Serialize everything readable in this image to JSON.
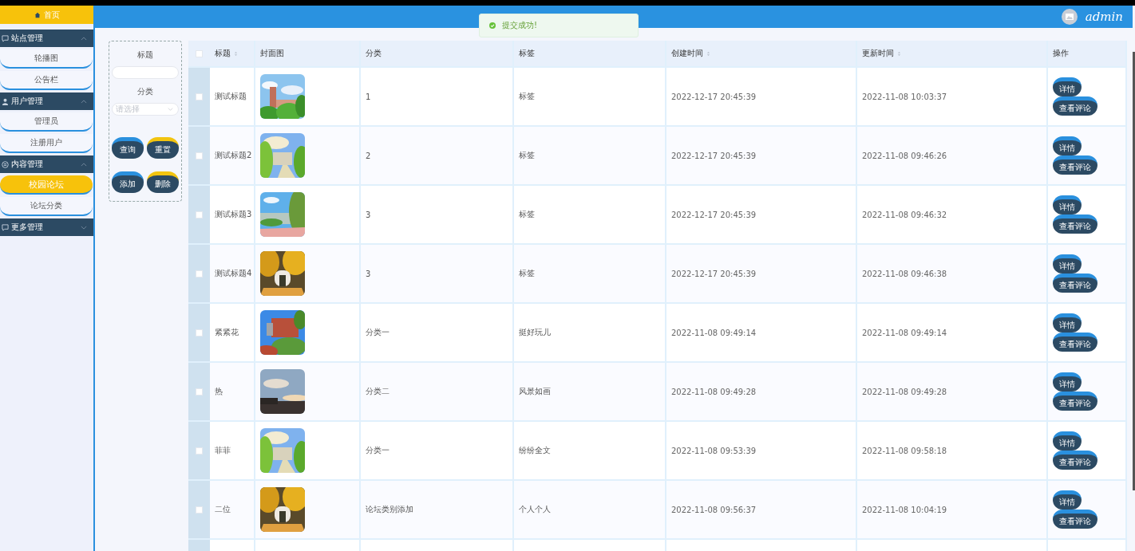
{
  "sidebar": {
    "home": {
      "label": "首页"
    },
    "groups": [
      {
        "label": "站点管理",
        "expanded": true,
        "items": [
          {
            "label": "轮播图",
            "selected": false
          },
          {
            "label": "公告栏",
            "selected": false
          }
        ]
      },
      {
        "label": "用户管理",
        "expanded": true,
        "items": [
          {
            "label": "管理员",
            "selected": false
          },
          {
            "label": "注册用户",
            "selected": false
          }
        ]
      },
      {
        "label": "内容管理",
        "expanded": true,
        "items": [
          {
            "label": "校园论坛",
            "selected": true
          },
          {
            "label": "论坛分类",
            "selected": false
          }
        ]
      },
      {
        "label": "更多管理",
        "expanded": false
      }
    ]
  },
  "header": {
    "user": "admin"
  },
  "toast": {
    "message": "提交成功!"
  },
  "filter": {
    "fields": [
      {
        "label": "标题",
        "kind": "text"
      },
      {
        "label": "分类",
        "kind": "select",
        "placeholder": "请选择"
      }
    ],
    "buttons": [
      {
        "label": "查询",
        "color": "#2a90de"
      },
      {
        "label": "重置",
        "color": "#f2c40f"
      },
      {
        "label": "添加",
        "color": "#2a90de"
      },
      {
        "label": "删除",
        "color": "#f2c40f"
      }
    ]
  },
  "table": {
    "all_checked": false,
    "columns": [
      {
        "label": "标题",
        "sortable": true
      },
      {
        "label": "封面图",
        "sortable": false
      },
      {
        "label": "分类",
        "sortable": false
      },
      {
        "label": "标签",
        "sortable": false
      },
      {
        "label": "创建时间",
        "sortable": true
      },
      {
        "label": "更新时间",
        "sortable": true
      },
      {
        "label": "操作",
        "sortable": false
      }
    ],
    "rows": [
      {
        "checked": false,
        "title": "测试标题",
        "category": "1",
        "tag": "标签",
        "created": "2022-12-17 20:45:39",
        "updated": "2022-11-08 10:03:37",
        "actions": [
          "详情",
          "查看评论"
        ]
      },
      {
        "checked": false,
        "title": "测试标题2",
        "category": "2",
        "tag": "标签",
        "created": "2022-12-17 20:45:39",
        "updated": "2022-11-08 09:46:26",
        "actions": [
          "详情",
          "查看评论"
        ]
      },
      {
        "checked": false,
        "title": "测试标题3",
        "category": "3",
        "tag": "标签",
        "created": "2022-12-17 20:45:39",
        "updated": "2022-11-08 09:46:32",
        "actions": [
          "详情",
          "查看评论"
        ]
      },
      {
        "checked": false,
        "title": "测试标题4",
        "category": "3",
        "tag": "标签",
        "created": "2022-12-17 20:45:39",
        "updated": "2022-11-08 09:46:38",
        "actions": [
          "详情",
          "查看评论"
        ]
      },
      {
        "checked": false,
        "title": "紧紧花",
        "category": "分类一",
        "tag": "挺好玩儿",
        "created": "2022-11-08 09:49:14",
        "updated": "2022-11-08 09:49:14",
        "actions": [
          "详情",
          "查看评论"
        ]
      },
      {
        "checked": false,
        "title": "热",
        "category": "分类二",
        "tag": "风景如画",
        "created": "2022-11-08 09:49:28",
        "updated": "2022-11-08 09:49:28",
        "actions": [
          "详情",
          "查看评论"
        ]
      },
      {
        "checked": false,
        "title": "菲菲",
        "category": "分类一",
        "tag": "纷纷全文",
        "created": "2022-11-08 09:53:39",
        "updated": "2022-11-08 09:58:18",
        "actions": [
          "详情",
          "查看评论"
        ]
      },
      {
        "checked": false,
        "title": "二位",
        "category": "论坛类别添加",
        "tag": "个人个人",
        "created": "2022-11-08 09:56:37",
        "updated": "2022-11-08 10:04:19",
        "actions": [
          "详情",
          "查看评论"
        ]
      }
    ]
  }
}
